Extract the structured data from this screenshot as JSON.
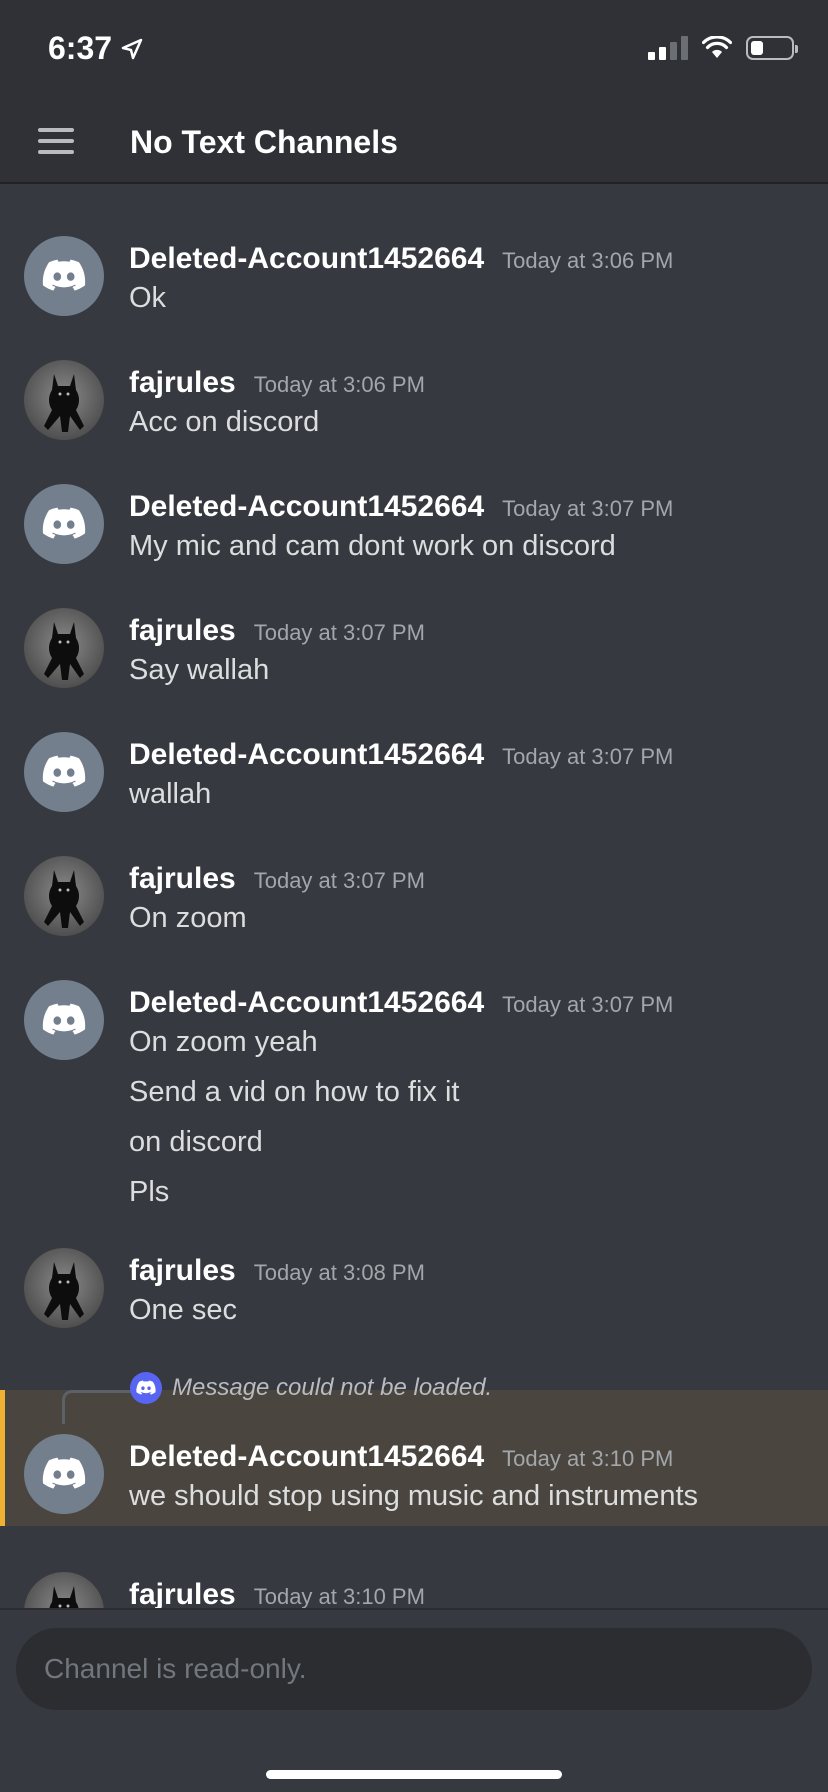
{
  "status_bar": {
    "time": "6:37"
  },
  "header": {
    "title": "No Text Channels"
  },
  "messages": [
    {
      "author": "Deleted-Account1452664",
      "time": "Today at 3:06 PM",
      "lines": [
        "Ok"
      ],
      "avatar": "discord-icon"
    },
    {
      "author": "fajrules",
      "time": "Today at 3:06 PM",
      "lines": [
        "Acc on discord"
      ],
      "avatar": "cat-avatar"
    },
    {
      "author": "Deleted-Account1452664",
      "time": "Today at 3:07 PM",
      "lines": [
        "My mic and cam dont work on discord"
      ],
      "avatar": "discord-icon"
    },
    {
      "author": "fajrules",
      "time": "Today at 3:07 PM",
      "lines": [
        "Say wallah"
      ],
      "avatar": "cat-avatar"
    },
    {
      "author": "Deleted-Account1452664",
      "time": "Today at 3:07 PM",
      "lines": [
        "wallah"
      ],
      "avatar": "discord-icon"
    },
    {
      "author": "fajrules",
      "time": "Today at 3:07 PM",
      "lines": [
        "On zoom"
      ],
      "avatar": "cat-avatar"
    },
    {
      "author": "Deleted-Account1452664",
      "time": "Today at 3:07 PM",
      "lines": [
        "On zoom yeah",
        "Send a vid on how to fix it",
        "on discord",
        "Pls"
      ],
      "avatar": "discord-icon"
    },
    {
      "author": "fajrules",
      "time": "Today at 3:08 PM",
      "lines": [
        "One sec"
      ],
      "avatar": "cat-avatar"
    },
    {
      "author": "Deleted-Account1452664",
      "time": "Today at 3:10 PM",
      "lines": [
        "we should stop using music and instruments"
      ],
      "avatar": "discord-icon",
      "reply": "Message could not be loaded."
    },
    {
      "author": "fajrules",
      "time": "Today at 3:10 PM",
      "lines": [],
      "avatar": "cat-avatar"
    }
  ],
  "input": {
    "placeholder": "Channel is read-only."
  },
  "colors": {
    "background": "#36393f",
    "header": "#2f3136",
    "highlight": "#4a463f",
    "highlight_bar": "#f0b232",
    "blurple": "#5865f2"
  }
}
